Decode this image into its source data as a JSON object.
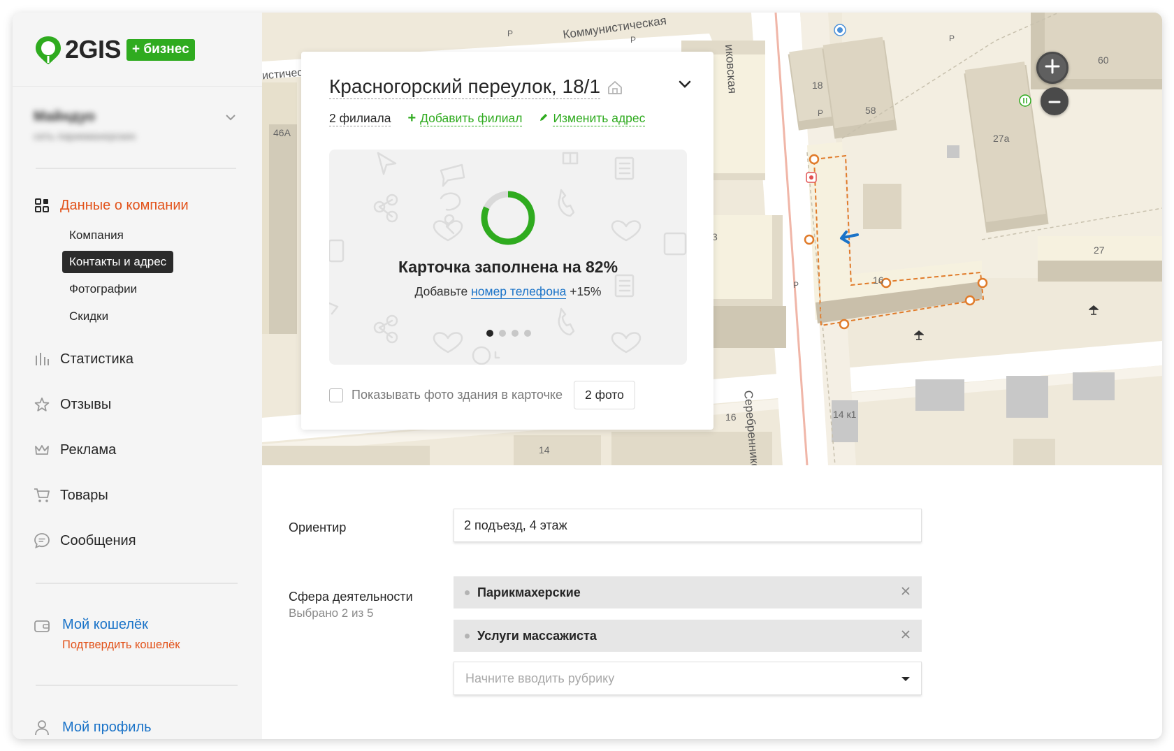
{
  "logo": {
    "text": "2GIS",
    "badge": "+ бизнес"
  },
  "account": {
    "name": "Майндуо",
    "subtitle": "сеть парикмахерских"
  },
  "nav": {
    "company_data": "Данные о компании",
    "sub_items": [
      "Компания",
      "Контакты и адрес",
      "Фотографии",
      "Скидки"
    ],
    "selected_sub": "Контакты и адрес",
    "statistics": "Статистика",
    "reviews": "Отзывы",
    "advertising": "Реклама",
    "products": "Товары",
    "messages": "Сообщения"
  },
  "wallet": {
    "label": "Мой кошелёк",
    "confirm": "Подтвердить кошелёк"
  },
  "profile": {
    "label": "Мой профиль"
  },
  "map": {
    "street_labels": [
      "Коммунистическая",
      "Серебренниковская",
      "иковская",
      "истичес"
    ],
    "house_numbers": [
      "18",
      "58",
      "27а",
      "60",
      "27",
      "16",
      "16",
      "14",
      "14 к1",
      "46А",
      "3"
    ],
    "parking_mark": "P"
  },
  "card": {
    "address": "Красногорский переулок, 18/1",
    "branches": "2 филиала",
    "add_branch": "Добавить филиал",
    "change_address": "Изменить адрес",
    "promo_title": "Карточка заполнена на 82%",
    "promo_prefix": "Добавьте ",
    "promo_link": "номер телефона",
    "promo_suffix": " +15%",
    "progress": 0.82,
    "slides": 4,
    "active_slide": 1,
    "show_building_photo": "Показывать фото здания в карточке",
    "photos_button": "2 фото"
  },
  "form": {
    "landmark_label": "Ориентир",
    "landmark_value": "2 подъезд, 4 этаж",
    "activity_label": "Сфера деятельности",
    "activity_sub": "Выбрано 2 из 5",
    "activities": [
      "Парикмахерские",
      "Услуги массажиста"
    ],
    "rubric_placeholder": "Начните вводить рубрику"
  },
  "colors": {
    "accent_orange": "#e2531b",
    "green": "#2fab1f",
    "link_blue": "#1a73c8",
    "selected_bg": "#2b2b2b"
  }
}
